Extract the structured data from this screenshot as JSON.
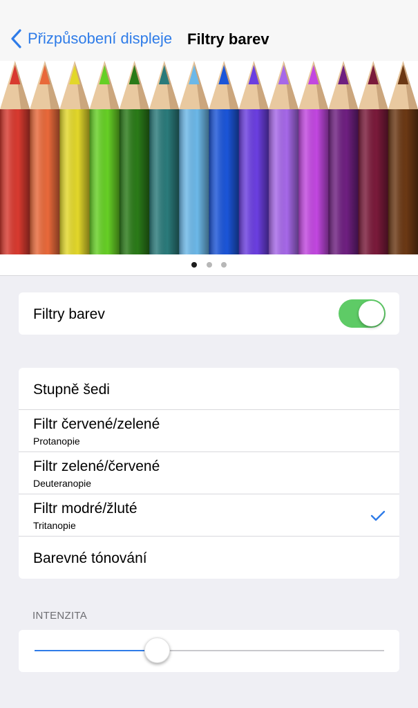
{
  "nav": {
    "back_label": "Přizpůsobení displeje",
    "title": "Filtry barev"
  },
  "pencils": [
    "#d83a2f",
    "#e8693a",
    "#e2d72a",
    "#66cf25",
    "#2a7a18",
    "#2a7a7a",
    "#6cb8e8",
    "#1b55d8",
    "#6b3ee0",
    "#a668e8",
    "#c247e0",
    "#6e1f80",
    "#7a1a3a",
    "#6b3814"
  ],
  "pager": {
    "count": 3,
    "active": 0
  },
  "toggle_section": {
    "label": "Filtry barev",
    "enabled": true
  },
  "filters": [
    {
      "label": "Stupně šedi",
      "sub": "",
      "checked": false
    },
    {
      "label": "Filtr červené/zelené",
      "sub": "Protanopie",
      "checked": false
    },
    {
      "label": "Filtr zelené/červené",
      "sub": "Deuteranopie",
      "checked": false
    },
    {
      "label": "Filtr modré/žluté",
      "sub": "Tritanopie",
      "checked": true
    },
    {
      "label": "Barevné tónování",
      "sub": "",
      "checked": false
    }
  ],
  "intensity": {
    "header": "INTENZITA",
    "value": 0.35
  },
  "colors": {
    "accent": "#2f7ce8",
    "toggle_on": "#5ecb66"
  }
}
